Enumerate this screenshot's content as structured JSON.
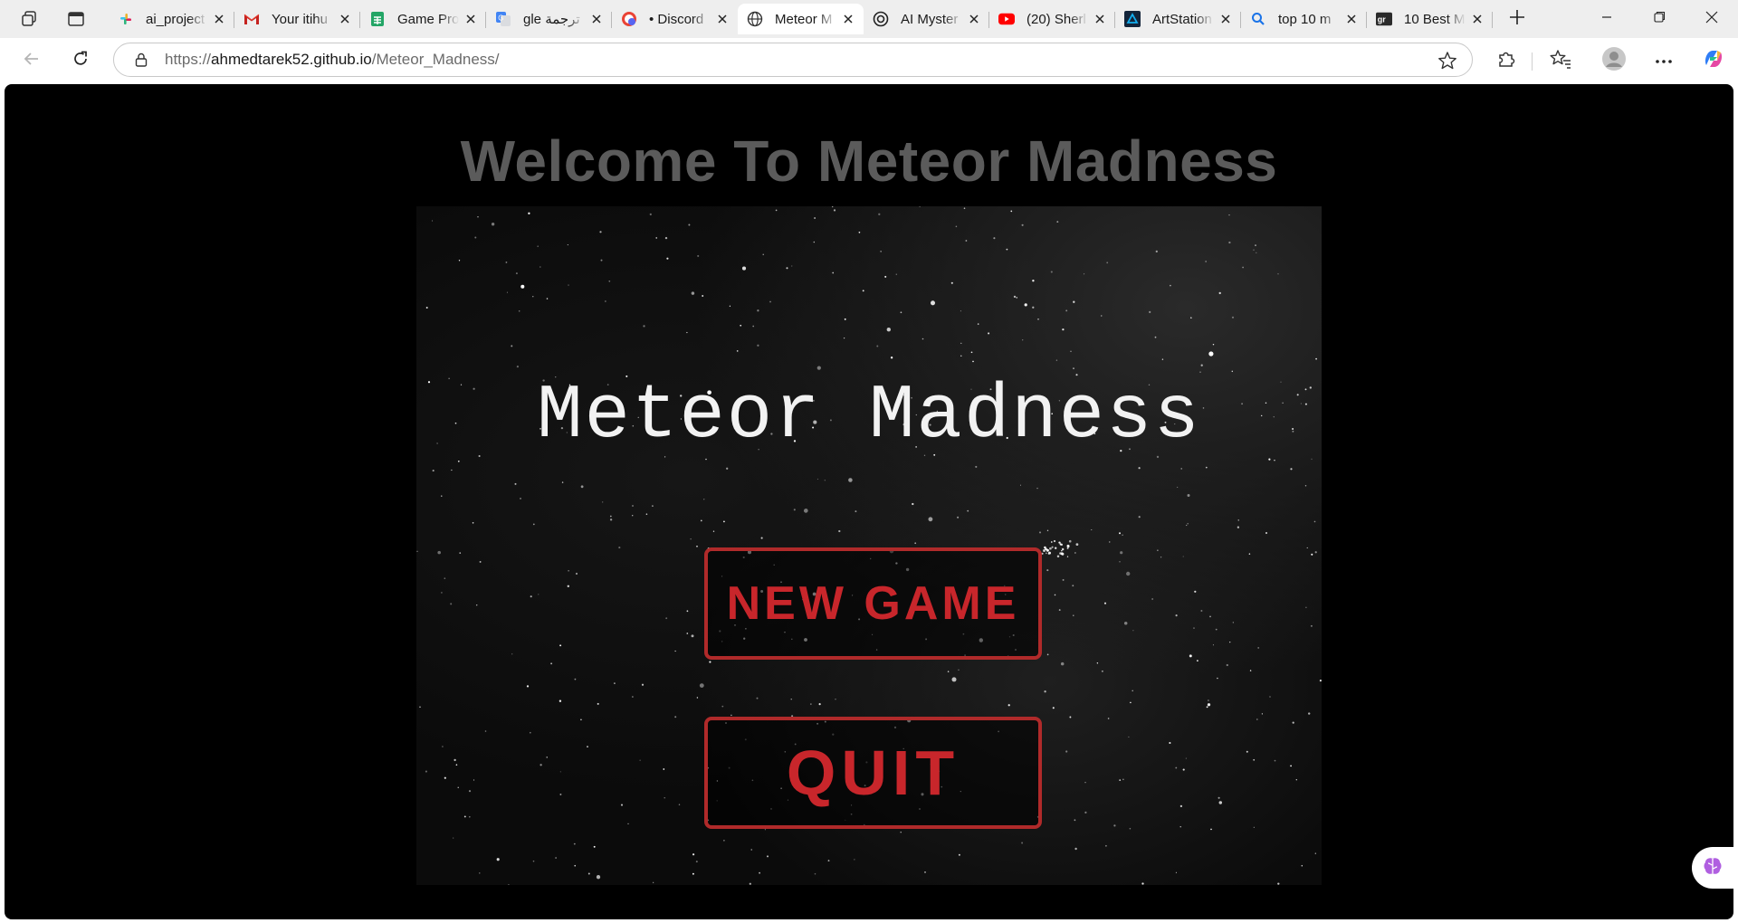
{
  "browser": {
    "tabs": [
      {
        "title": "ai_project",
        "icon": "slack-icon"
      },
      {
        "title": "Your itihu",
        "icon": "gmail-icon"
      },
      {
        "title": "Game Pro",
        "icon": "sheets-icon"
      },
      {
        "title": "gle ترجمة",
        "icon": "translate-icon"
      },
      {
        "title": "• Discord",
        "icon": "discord-icon"
      },
      {
        "title": "Meteor M",
        "icon": "globe-icon",
        "active": true
      },
      {
        "title": "AI Myster",
        "icon": "openai-icon"
      },
      {
        "title": "(20) Sherl",
        "icon": "youtube-icon"
      },
      {
        "title": "ArtStation",
        "icon": "artstation-icon"
      },
      {
        "title": "top 10 m",
        "icon": "search-icon"
      },
      {
        "title": "10 Best M",
        "icon": "gr-icon"
      }
    ],
    "address": {
      "scheme": "https://",
      "host": "ahmedtarek52.github.io",
      "path": "/Meteor_Madness/"
    }
  },
  "page": {
    "heading": "Welcome To Meteor Madness",
    "game": {
      "title": "Meteor Madness",
      "buttons": {
        "new_game": "NEW GAME",
        "quit": "QUIT"
      }
    }
  },
  "colors": {
    "heading": "#5b5b5b",
    "button_red": "#c8262b",
    "background": "#000000"
  }
}
